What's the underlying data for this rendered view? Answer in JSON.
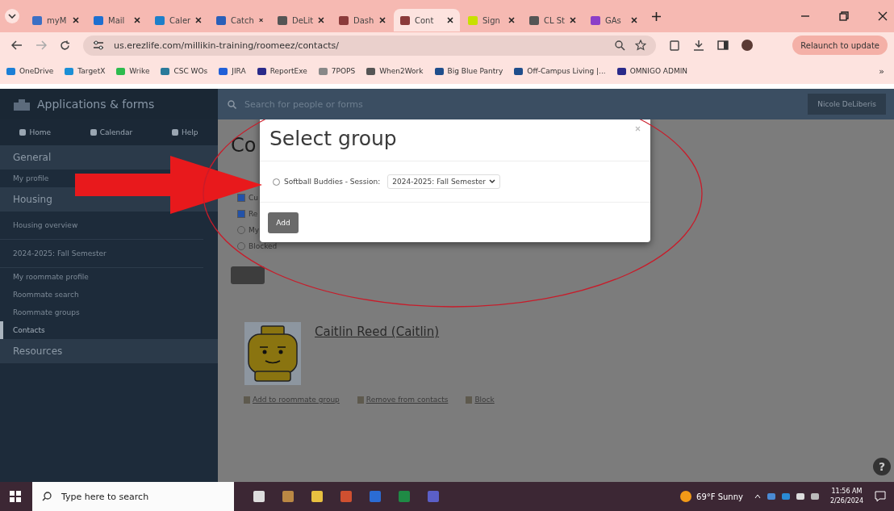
{
  "browser": {
    "tabs": [
      {
        "label": "myM",
        "selected": false,
        "color": "#3b6fc4"
      },
      {
        "label": "Mail",
        "selected": false,
        "color": "#1e6fd0"
      },
      {
        "label": "Caler",
        "selected": false,
        "color": "#1d7fc9"
      },
      {
        "label": "Catch",
        "selected": false,
        "color": "#2a5fb8"
      },
      {
        "label": "DeLit",
        "selected": false,
        "color": "#555555"
      },
      {
        "label": "Dash",
        "selected": false,
        "color": "#8b3a3a"
      },
      {
        "label": "Cont",
        "selected": true,
        "color": "#8b3a3a"
      },
      {
        "label": "Sign",
        "selected": false,
        "color": "#c8e000"
      },
      {
        "label": "CL St",
        "selected": false,
        "color": "#555555"
      },
      {
        "label": "GAs",
        "selected": false,
        "color": "#8b3fc8"
      }
    ],
    "address": "us.erezlife.com/millikin-training/roomeez/contacts/",
    "relaunch": "Relaunch to update",
    "bookmarks": [
      {
        "label": "OneDrive",
        "color": "#1b7fd6"
      },
      {
        "label": "TargetX",
        "color": "#1b8fd6"
      },
      {
        "label": "Wrike",
        "color": "#2dbb4e"
      },
      {
        "label": "CSC WOs",
        "color": "#2a7a9a"
      },
      {
        "label": "JIRA",
        "color": "#2160d8"
      },
      {
        "label": "ReportExe",
        "color": "#2a2a8a"
      },
      {
        "label": "7POPS",
        "color": "#888888"
      },
      {
        "label": "When2Work",
        "color": "#555555"
      },
      {
        "label": "Big Blue Pantry",
        "color": "#1f4e8c"
      },
      {
        "label": "Off-Campus Living |...",
        "color": "#1f4e8c"
      },
      {
        "label": "OMNIGO ADMIN",
        "color": "#2a2a8a"
      }
    ],
    "more": "»"
  },
  "app": {
    "brand": "Applications & forms",
    "nav": [
      "Home",
      "Calendar",
      "Help"
    ],
    "sections": [
      {
        "title": "General",
        "items": [
          {
            "label": "My profile",
            "selected": false,
            "separated": false
          }
        ]
      },
      {
        "title": "Housing",
        "items": [
          {
            "label": "Housing overview",
            "selected": false,
            "separated": true
          },
          {
            "label": "2024-2025: Fall Semester",
            "selected": false,
            "separated": true
          },
          {
            "label": "My roommate profile",
            "selected": false,
            "separated": false
          },
          {
            "label": "Roommate search",
            "selected": false,
            "separated": false
          },
          {
            "label": "Roommate groups",
            "selected": false,
            "separated": false
          },
          {
            "label": "Contacts",
            "selected": true,
            "separated": false
          }
        ]
      },
      {
        "title": "Resources"
      }
    ],
    "search": {
      "placeholder": "Search for people or forms"
    },
    "user": "Nicole DeLiberis",
    "page_title": "Co",
    "filters": [
      {
        "label": "Cu",
        "kind": "checkbox",
        "checked": true
      },
      {
        "label": "Re",
        "kind": "checkbox",
        "checked": true
      },
      {
        "label": "My",
        "kind": "radio",
        "checked": false
      },
      {
        "label": "Blocked",
        "kind": "radio",
        "checked": false
      }
    ],
    "contact": {
      "name": "Caitlin Reed (Caitlin)",
      "actions": [
        "Add to roommate group",
        "Remove from contacts",
        "Block"
      ]
    },
    "help": "?"
  },
  "modal": {
    "title": "Select group",
    "option": {
      "label": "Softball Buddies - Session:",
      "selected": false
    },
    "session": "2024-2025: Fall Semester",
    "button": "Add"
  },
  "taskbar": {
    "search": {
      "placeholder": "Type here to search"
    },
    "weather": "69°F Sunny",
    "time": "11:56 AM",
    "date": "2/26/2024"
  }
}
